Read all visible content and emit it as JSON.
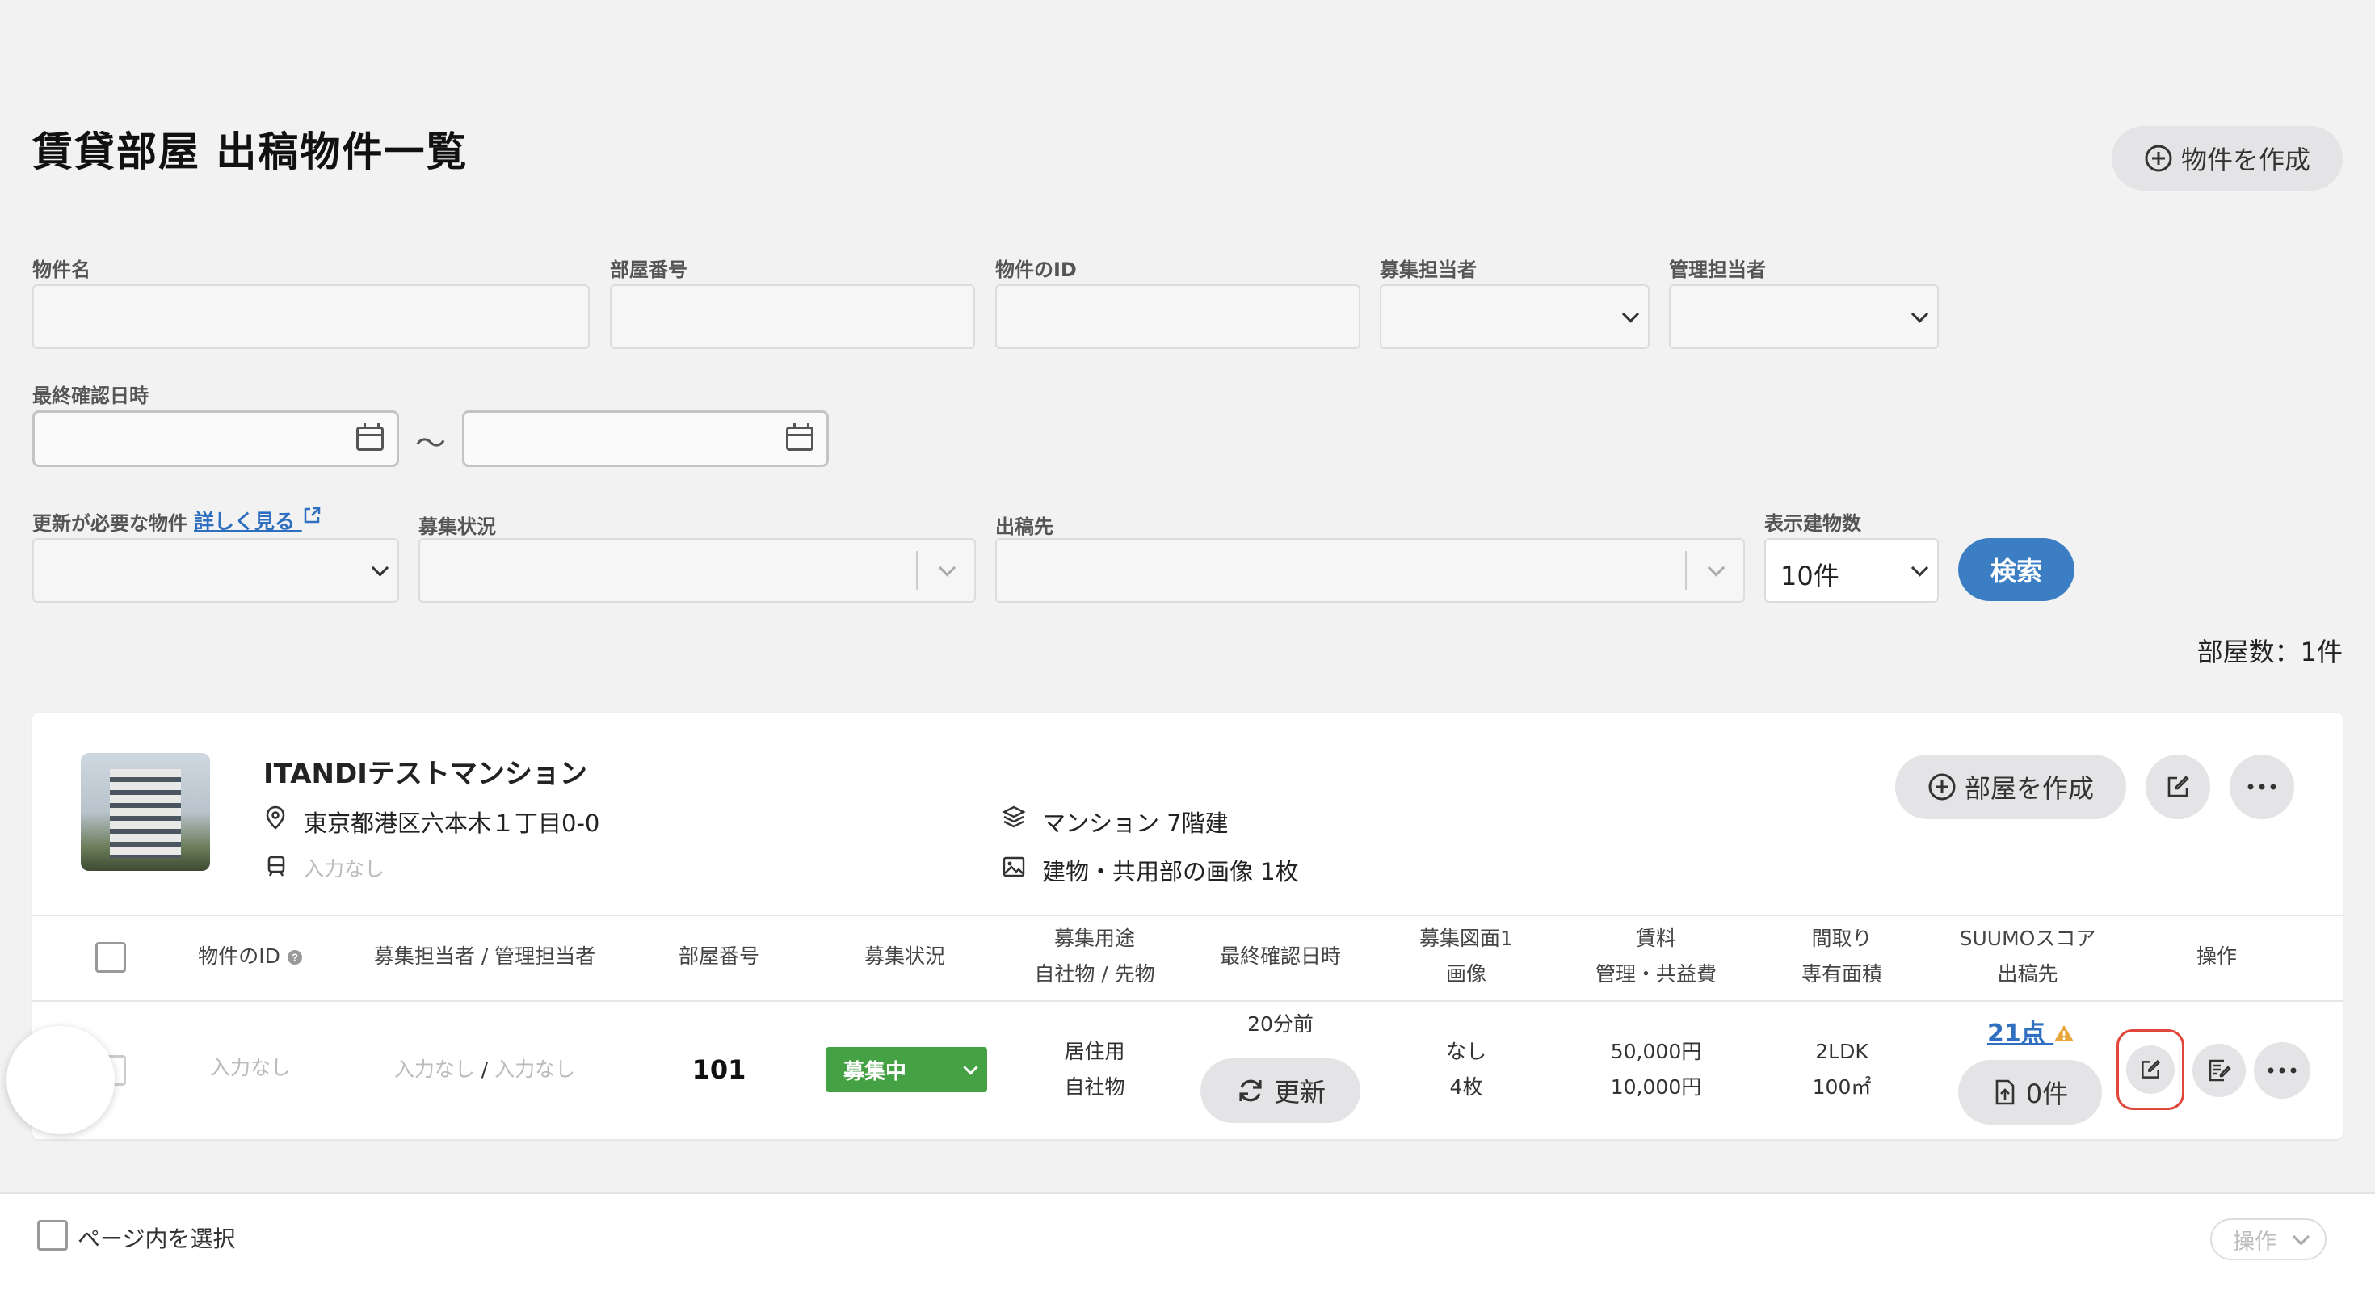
{
  "header": {
    "title": "賃貸部屋 出稿物件一覧",
    "create_property_label": "物件を作成"
  },
  "filters": {
    "property_name_label": "物件名",
    "room_number_label": "部屋番号",
    "property_id_label": "物件のID",
    "recruiter_label": "募集担当者",
    "manager_label": "管理担当者",
    "last_confirmed_label": "最終確認日時",
    "range_separator": "〜",
    "needs_update_label": "更新が必要な物件",
    "details_link": "詳しく見る",
    "recruitment_status_label": "募集状況",
    "publish_target_label": "出稿先",
    "display_count_label": "表示建物数",
    "display_count_value": "10件",
    "search_label": "検索"
  },
  "summary": {
    "room_count": "部屋数：1件"
  },
  "property": {
    "name": "ITANDIテストマンション",
    "address": "東京都港区六本木１丁目0-0",
    "station": "入力なし",
    "building_type": "マンション 7階建",
    "images": "建物・共用部の画像 1枚",
    "create_room_label": "部屋を作成"
  },
  "table": {
    "headers": {
      "property_id": "物件のID",
      "staff": "募集担当者 / 管理担当者",
      "room_number": "部屋番号",
      "status": "募集状況",
      "purpose_1": "募集用途",
      "purpose_2": "自社物 / 先物",
      "last_confirmed": "最終確認日時",
      "floorplan_1": "募集図面1",
      "floorplan_2": "画像",
      "rent_1": "賃料",
      "rent_2": "管理・共益費",
      "layout_1": "間取り",
      "layout_2": "専有面積",
      "suumo_1": "SUUMOスコア",
      "suumo_2": "出稿先",
      "actions": "操作"
    },
    "row": {
      "property_id": "入力なし",
      "recruiter": "入力なし",
      "staff_sep": "/",
      "manager": "入力なし",
      "room_number": "101",
      "status": "募集中",
      "purpose": "居住用",
      "ownership": "自社物",
      "last_confirmed": "20分前",
      "update_label": "更新",
      "floorplan": "なし",
      "image_count": "4枚",
      "rent": "50,000円",
      "fee": "10,000円",
      "layout": "2LDK",
      "area": "100㎡",
      "suumo_score": "21点",
      "publish_count": "0件"
    }
  },
  "footer": {
    "select_page_label": "ページ内を選択",
    "actions_label": "操作"
  },
  "colors": {
    "accent": "#3c7ec4",
    "status_green": "#45a244",
    "warning": "#e8a53a",
    "highlight": "#e0463a"
  }
}
